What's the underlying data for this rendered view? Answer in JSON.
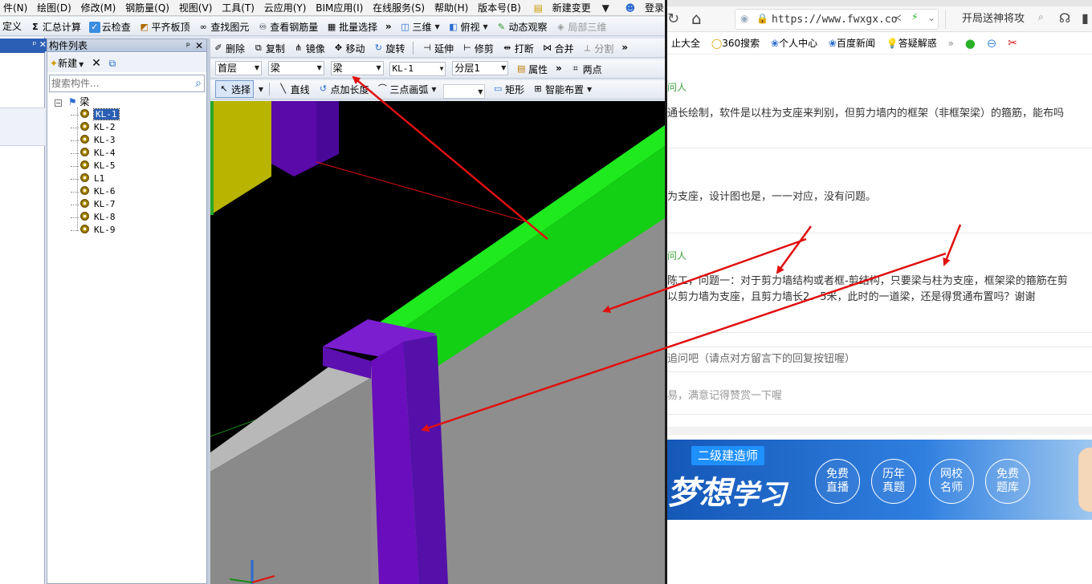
{
  "menu": [
    "件(N)",
    "绘图(D)",
    "修改(M)",
    "钢筋量(Q)",
    "视图(V)",
    "工具(T)",
    "云应用(Y)",
    "BIM应用(I)",
    "在线服务(S)",
    "帮助(H)",
    "版本号(B)"
  ],
  "menu_right": {
    "new_change": "新建变更",
    "login": "登录"
  },
  "toolbar1": [
    "定义",
    "汇总计算",
    "云检查",
    "平齐板顶",
    "查找图元",
    "查看钢筋量",
    "批量选择"
  ],
  "toolbar1_right": {
    "view3d": "三维",
    "topview": "俯视",
    "dynamic": "动态观察",
    "local3d": "局部三维"
  },
  "edit_toolbar": [
    "删除",
    "复制",
    "镜像",
    "移动",
    "旋转",
    "延伸",
    "修剪",
    "打断",
    "合并",
    "分割"
  ],
  "filter_bar": {
    "floor": "首层",
    "type": "梁",
    "subtype": "梁",
    "component": "KL-1",
    "layer": "分层1",
    "properties": "属性",
    "two_points": "两点"
  },
  "draw_bar": {
    "select": "选择",
    "line": "直线",
    "point_length": "点加长度",
    "arc": "三点画弧",
    "rect": "矩形",
    "smart": "智能布置"
  },
  "panel": {
    "title": "构件列表",
    "new_label": "新建",
    "search_placeholder": "搜索构件..."
  },
  "tree": {
    "root": "梁",
    "items": [
      "KL-1",
      "KL-2",
      "KL-3",
      "KL-4",
      "KL-5",
      "L1",
      "KL-6",
      "KL-7",
      "KL-8",
      "KL-9"
    ],
    "selected": "KL-1"
  },
  "browser": {
    "url": "https://www.fwxgx.co",
    "search_text": "开局送神将攻",
    "bookmarks": [
      "止大全",
      "360搜索",
      "个人中心",
      "百度新闻",
      "答疑解惑"
    ],
    "q1_label": "问人",
    "q1_text": "通长绘制，软件是以柱为支座来判别，但剪力墙内的框架（非框架梁）的箍筋，能布吗",
    "a1_text": "为支座，设计图也是，一一对应，没有问题。",
    "q2_label": "问人",
    "q2_line1": "陈工，问题一：对于剪力墙结构或者框-剪结构，只要梁与柱为支座，框架梁的箍筋在剪",
    "q2_line2": "以剪力墙为支座，且剪力墙长2．5米，此时的一道梁，还是得贯通布置吗？谢谢",
    "followup_placeholder": "追问吧（请点对方留言下的回复按钮喔）",
    "thanks_text": "易，满意记得赞赏一下喔",
    "banner": {
      "tag": "二级建造师",
      "slogan_a": "梦",
      "slogan_b": "想",
      "slogan_c": "学习",
      "circles": [
        "免费\n直播",
        "历年\n真题",
        "网校\n名师",
        "免费\n题库"
      ]
    }
  },
  "colors": {
    "beam_green": "#19e619",
    "column_purple": "#6a0dbd",
    "wall_gray": "#8e8e8e",
    "arrow_red": "#e01010",
    "banner_blue": "#1f6fd0"
  }
}
